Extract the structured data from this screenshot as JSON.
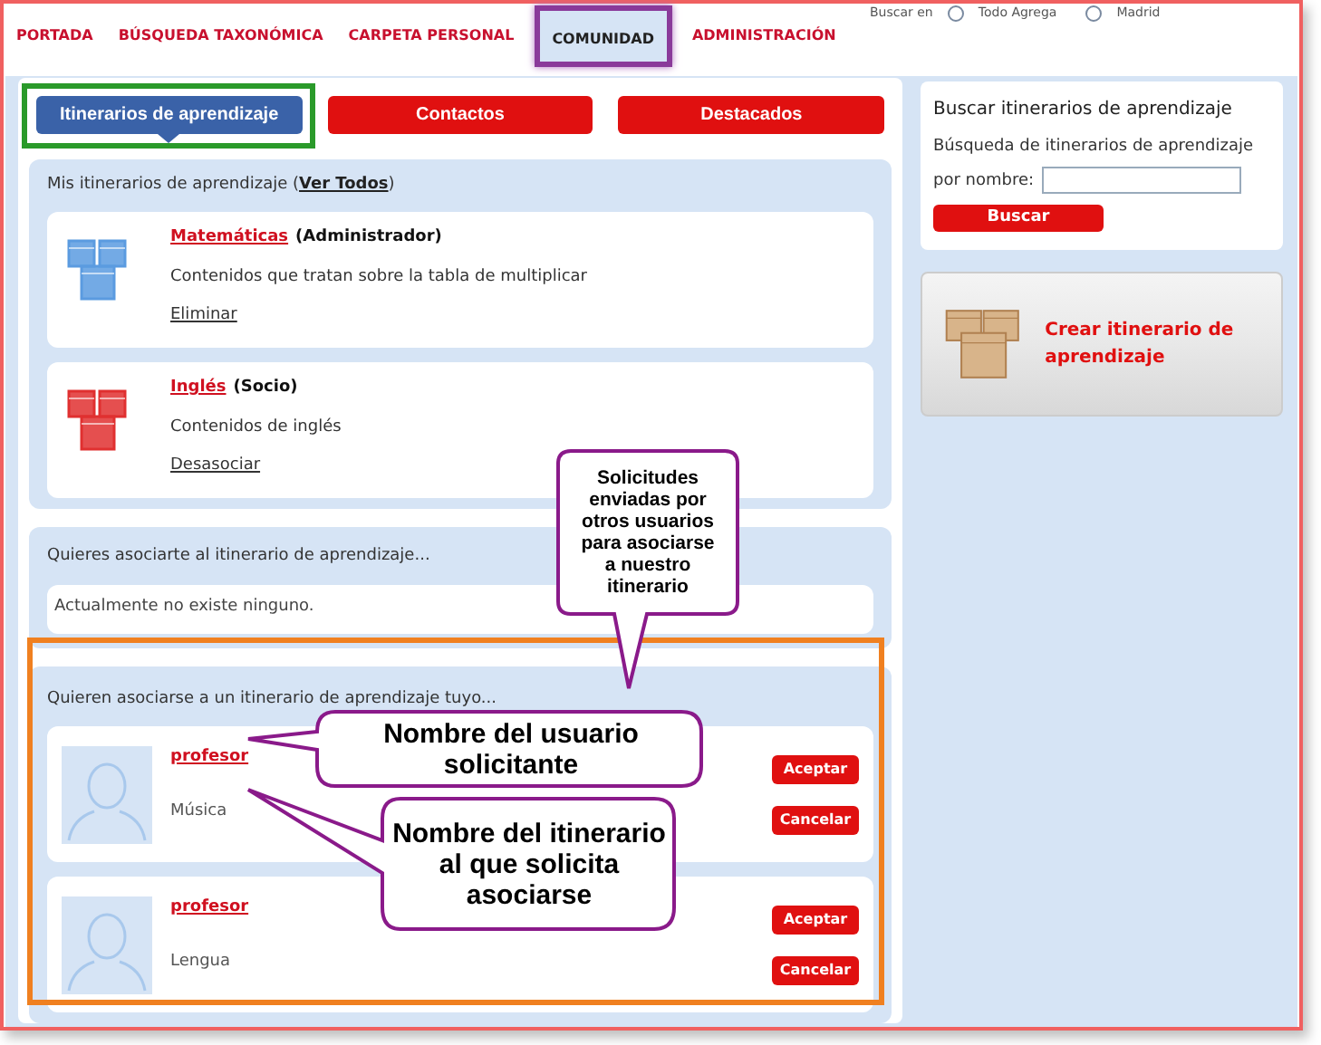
{
  "top_search": {
    "label": "Buscar en",
    "options": [
      {
        "label": "Todo Agrega",
        "selected": false
      },
      {
        "label": "Madrid",
        "selected": false
      }
    ]
  },
  "nav": [
    {
      "label": "PORTADA",
      "selected": false
    },
    {
      "label": "BÚSQUEDA TAXONÓMICA",
      "selected": false
    },
    {
      "label": "CARPETA PERSONAL",
      "selected": false
    },
    {
      "label": "COMUNIDAD",
      "selected": true
    },
    {
      "label": "ADMINISTRACIÓN",
      "selected": false
    }
  ],
  "tabs": [
    {
      "label": "Itinerarios de aprendizaje",
      "selected": true
    },
    {
      "label": "Contactos",
      "selected": false
    },
    {
      "label": "Destacados",
      "selected": false
    }
  ],
  "my_itineraries": {
    "title_before": "Mis itinerarios de aprendizaje (",
    "link": "Ver Todos",
    "title_after": ")",
    "items": [
      {
        "name": "Matemáticas",
        "role": "(Administrador)",
        "description": "Contenidos que tratan sobre la tabla de multiplicar",
        "action": "Eliminar",
        "color": "#5b9be0"
      },
      {
        "name": "Inglés",
        "role": "(Socio)",
        "description": "Contenidos de inglés",
        "action": "Desasociar",
        "color": "#e03030"
      }
    ]
  },
  "want_to_join": {
    "title": "Quieres asociarte al itinerario de aprendizaje...",
    "empty_text": "Actualmente no existe ninguno."
  },
  "requests": {
    "title": "Quieren asociarse a un itinerario de aprendizaje tuyo...",
    "items": [
      {
        "user": "profesor",
        "itinerary": "Música",
        "accept": "Aceptar",
        "cancel": "Cancelar"
      },
      {
        "user": "profesor",
        "itinerary": "Lengua",
        "accept": "Aceptar",
        "cancel": "Cancelar"
      }
    ]
  },
  "search_panel": {
    "title": "Buscar itinerarios de aprendizaje",
    "label": [
      "Búsqueda de itinerarios de aprendizaje",
      "por nombre:"
    ],
    "button": "Buscar"
  },
  "create": {
    "label": "Crear itinerario de aprendizaje"
  },
  "callouts": [
    {
      "text": "Solicitudes enviadas por otros usuarios para asociarse a nuestro itinerario"
    },
    {
      "text": "Nombre del usuario solicitante"
    },
    {
      "text": "Nombre del itinerario al que solicita asociarse"
    }
  ]
}
